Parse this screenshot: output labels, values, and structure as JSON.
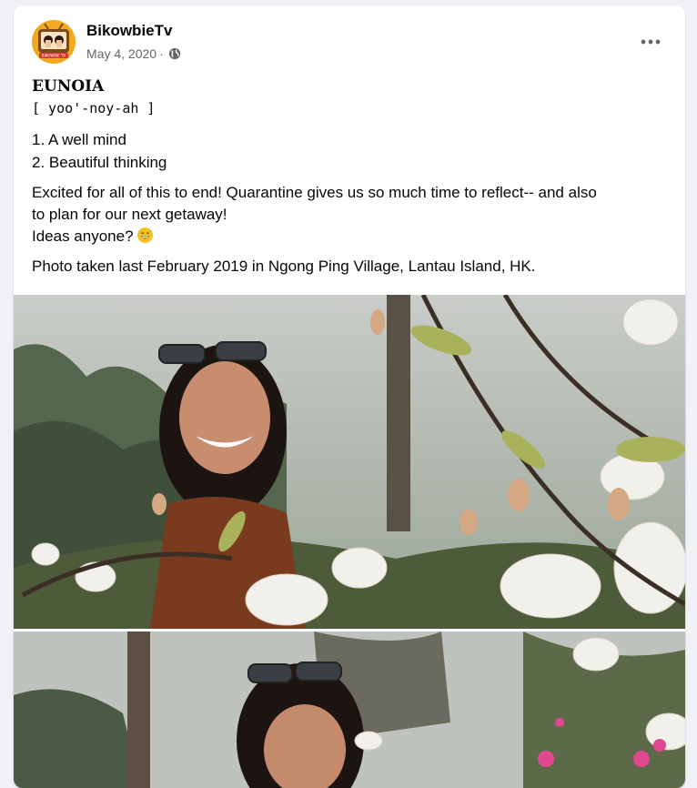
{
  "post": {
    "author": "BikowbieTv",
    "date": "May 4, 2020",
    "date_separator": "·",
    "privacy_icon": "globe-icon",
    "more_icon": "more-options-icon",
    "avatar_icon": "tv-avatar-icon",
    "avatar_logo_text": "BIKOWBIE TV",
    "title": "EUNOIA",
    "pronunciation": "[ yoo'-noy-ah ]",
    "definitions": [
      "1. A well mind",
      "2. Beautiful thinking"
    ],
    "paragraph1_line1": "Excited for all of this to end! Quarantine gives us so much time to reflect-- and also",
    "paragraph1_line2": "to plan for our next getaway!",
    "paragraph1_line3": "Ideas anyone?",
    "emoji": "grinning-sweat-emoji",
    "paragraph2": "Photo taken last February 2019 in Ngong Ping Village, Lantau Island, HK."
  },
  "photos": [
    {
      "name": "photo-woman-magnolia-1",
      "subject": "woman with sunglasses on head among white magnolia blossoms"
    },
    {
      "name": "photo-woman-magnolia-2",
      "subject": "woman with sunglasses on head among flowers and trees"
    }
  ],
  "colors": {
    "background": "#f0f2f5",
    "card": "#ffffff",
    "text": "#050505",
    "secondary": "#65676b",
    "avatar_bg": "#f2a91f"
  }
}
